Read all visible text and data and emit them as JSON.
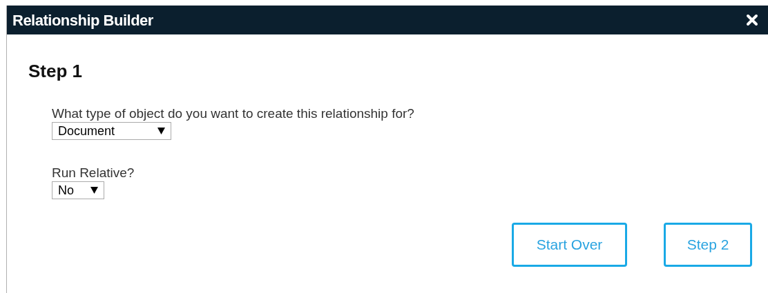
{
  "window": {
    "title": "Relationship Builder"
  },
  "heading": "Step 1",
  "fields": [
    {
      "label": "What type of object do you want to create this relationship for?",
      "value": "Document"
    },
    {
      "label": "Run Relative?",
      "value": "No"
    }
  ],
  "buttons": [
    "Start Over",
    "Step 2"
  ]
}
